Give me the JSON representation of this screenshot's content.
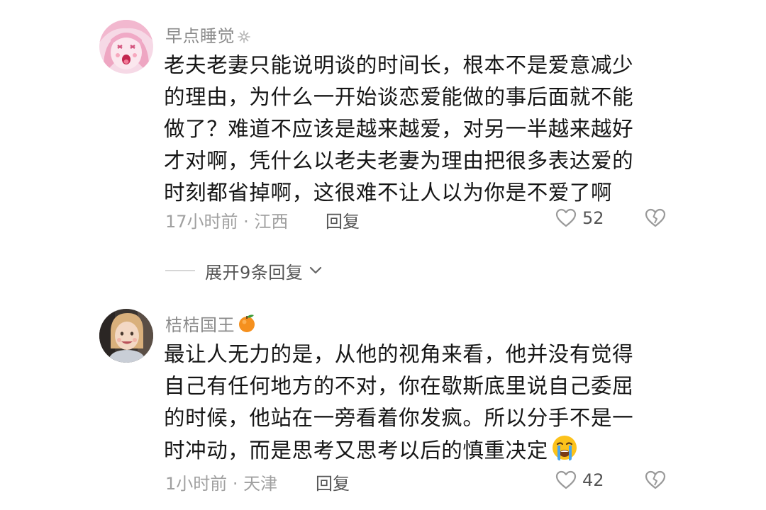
{
  "comments": [
    {
      "username": "早点睡觉",
      "badge_icon": "sparkle-badge-icon",
      "content_lines": [
        "老夫老妻只能说明谈的时间长，根本不是爱意减少",
        "的理由，为什么一开始谈恋爱能做的事后面就不能",
        "做了？难道不应该是越来越爱，对另一半越来越好",
        "才对啊，凭什么以老夫老妻为理由把很多表达爱的",
        "时刻都省掉啊，这很难不让人以为你是不爱了啊"
      ],
      "meta": {
        "time_location": "17小时前 · 江西",
        "reply_label": "回复"
      },
      "likes": "52"
    },
    {
      "username": "桔桔国王",
      "badge_icon": "tangerine-icon",
      "content_lines": [
        "最让人无力的是，从他的视角来看，他并没有觉得",
        "自己有任何地方的不对，你在歇斯底里说自己委屈",
        "的时候，他站在一旁看着你发疯。所以分手不是一",
        "时冲动，而是思考又思考以后的慎重决定"
      ],
      "content_emoji": "crying-face-emoji",
      "meta": {
        "time_location": "1小时前 · 天津",
        "reply_label": "回复"
      },
      "likes": "42"
    }
  ],
  "expand_replies": {
    "label": "展开9条回复"
  },
  "colors": {
    "text_primary": "#161616",
    "text_secondary": "#8a8a8a",
    "text_meta": "#a0a0a0",
    "icon_gray": "#9a9a9a"
  }
}
